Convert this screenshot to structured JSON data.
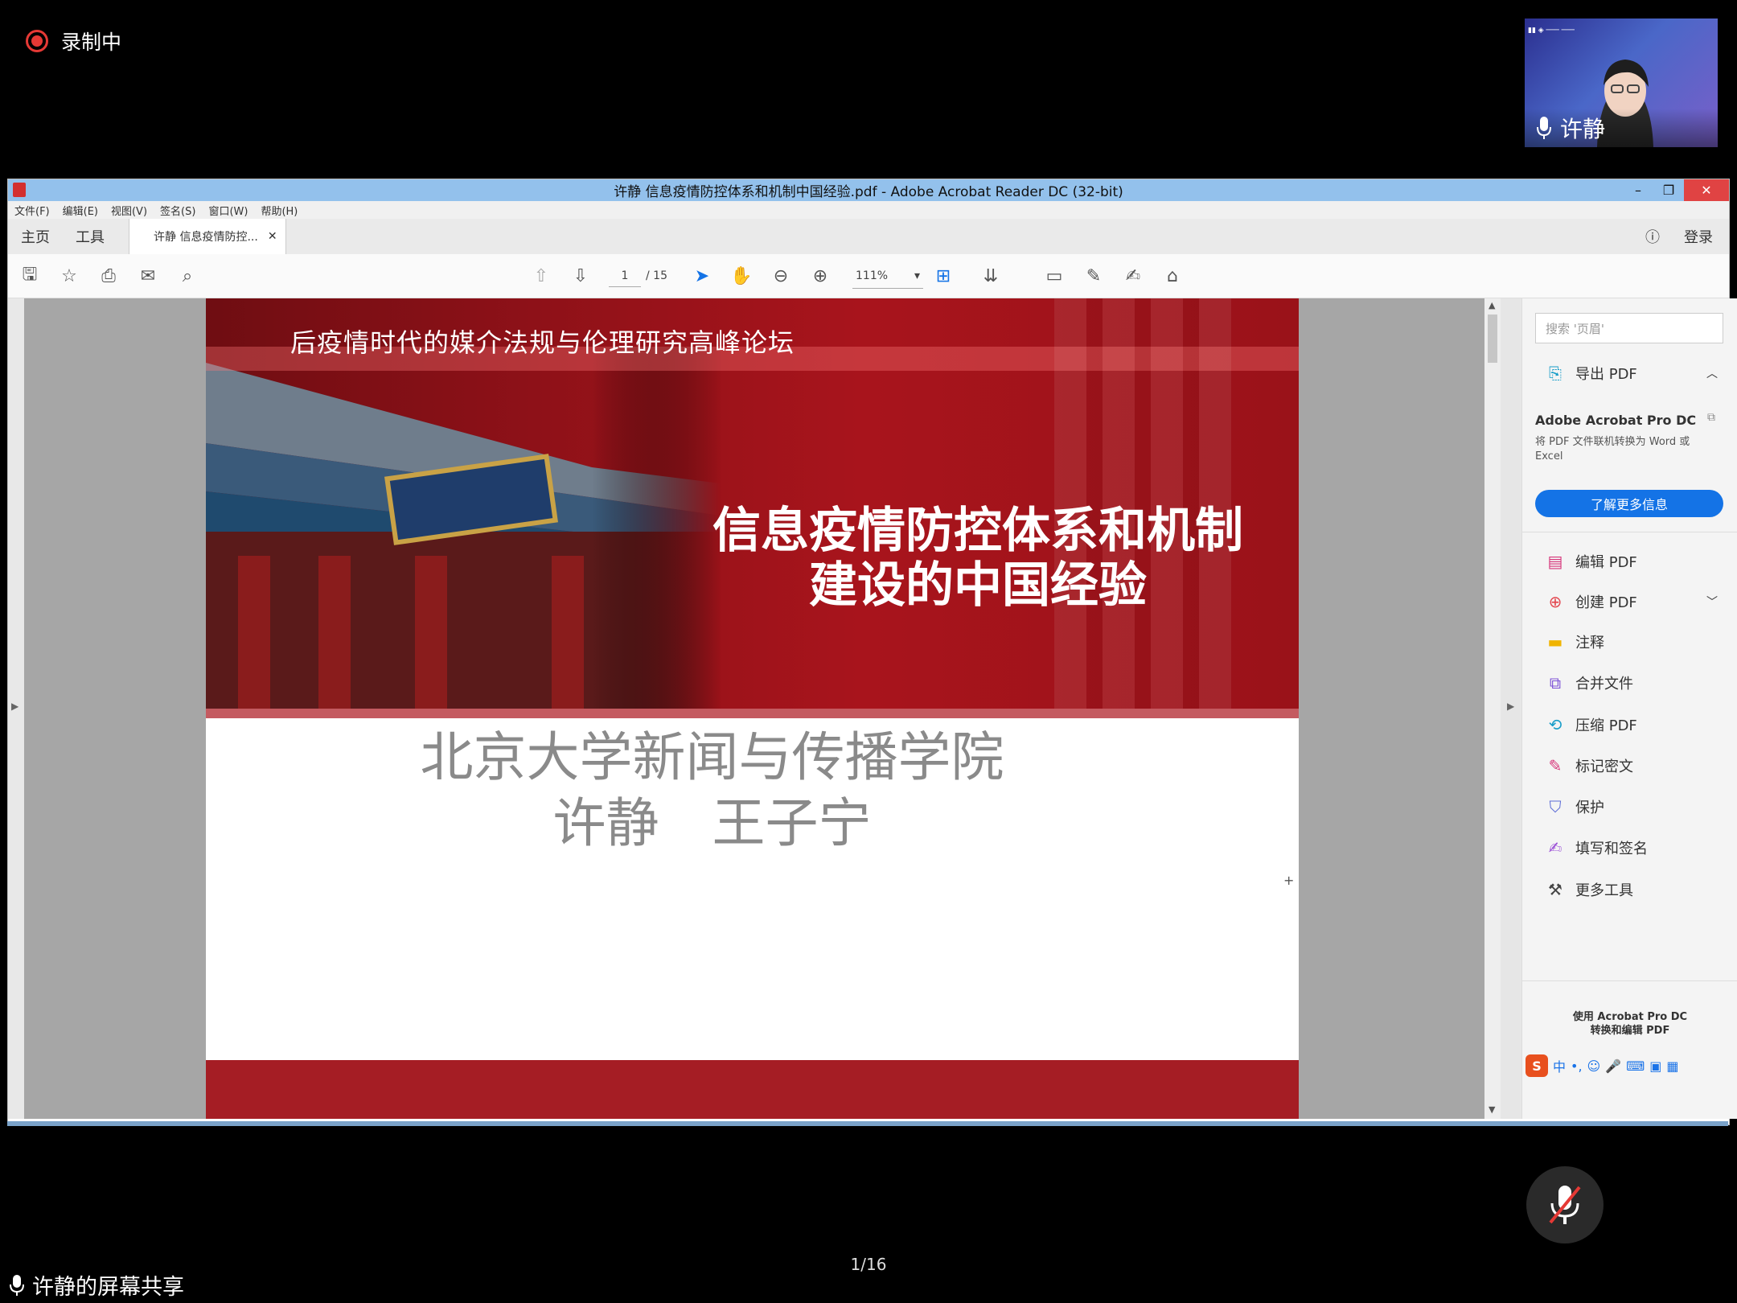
{
  "meeting": {
    "recording_label": "录制中",
    "participant_name": "许静",
    "share_label": "许静的屏幕共享",
    "page_indicator": "1/16"
  },
  "window": {
    "title": "许静 信息疫情防控体系和机制中国经验.pdf - Adobe Acrobat Reader DC (32-bit)",
    "menu": [
      "文件(F)",
      "编辑(E)",
      "视图(V)",
      "签名(S)",
      "窗口(W)",
      "帮助(H)"
    ],
    "tabs": {
      "home": "主页",
      "tools": "工具",
      "doc": "许静 信息疫情防控..."
    },
    "login": "登录",
    "page_current": "1",
    "page_total": "/ 15",
    "zoom": "111%"
  },
  "slide": {
    "forum": "后疫情时代的媒介法规与伦理研究高峰论坛",
    "title_line1": "信息疫情防控体系和机制",
    "title_line2": "建设的中国经验",
    "school": "北京大学新闻与传播学院",
    "authors": "许静　王子宁"
  },
  "panel": {
    "search_placeholder": "搜索 '页眉'",
    "export": "导出 PDF",
    "promo_title": "Adobe Acrobat Pro DC",
    "promo_desc": "将 PDF 文件联机转换为 Word 或 Excel",
    "learn_more": "了解更多信息",
    "tools": [
      {
        "label": "编辑 PDF",
        "icon": "edit-pdf-icon",
        "color": "#d6367a"
      },
      {
        "label": "创建 PDF",
        "icon": "create-pdf-icon",
        "color": "#e34850"
      },
      {
        "label": "注释",
        "icon": "comment-icon",
        "color": "#f0b400"
      },
      {
        "label": "合并文件",
        "icon": "combine-icon",
        "color": "#7b4fd6"
      },
      {
        "label": "压缩 PDF",
        "icon": "compress-icon",
        "color": "#1a9ec9"
      },
      {
        "label": "标记密文",
        "icon": "redact-icon",
        "color": "#d6367a"
      },
      {
        "label": "保护",
        "icon": "shield-icon",
        "color": "#5b6bd6"
      },
      {
        "label": "填写和签名",
        "icon": "sign-icon",
        "color": "#9b4fd6"
      },
      {
        "label": "更多工具",
        "icon": "more-tools-icon",
        "color": "#444444"
      }
    ],
    "use_pro": "使用 Acrobat Pro DC\n转换和编辑 PDF"
  },
  "ime": {
    "label": "中"
  }
}
